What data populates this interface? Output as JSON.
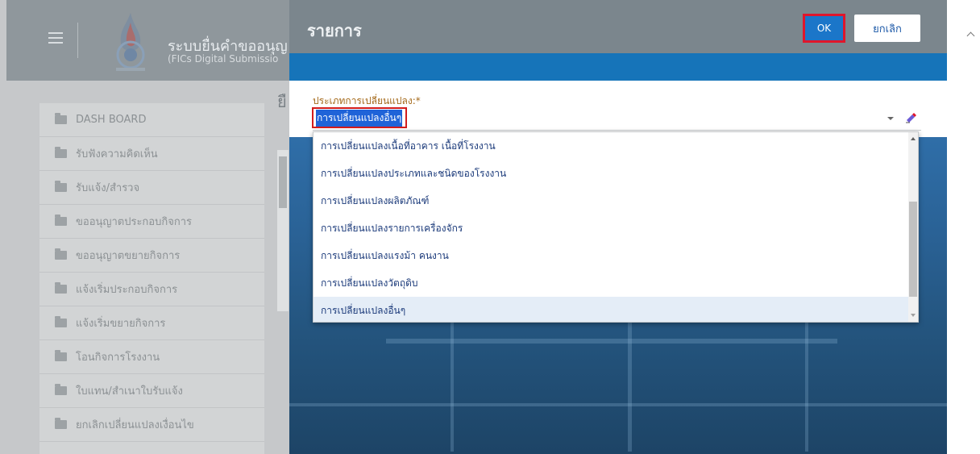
{
  "app": {
    "title": "ระบบยื่นคำขออนุญ",
    "subtitle": "(FICs Digital Submissio",
    "ghost_heading": "ยื"
  },
  "sidebar": {
    "items": [
      {
        "label": "DASH BOARD",
        "icon": "folder-icon"
      },
      {
        "label": "รับฟังความคิดเห็น",
        "icon": "folder-icon"
      },
      {
        "label": "รับแจ้ง/สำรวจ",
        "icon": "folder-icon"
      },
      {
        "label": "ขออนุญาตประกอบกิจการ",
        "icon": "folder-icon"
      },
      {
        "label": "ขออนุญาตขยายกิจการ",
        "icon": "folder-icon"
      },
      {
        "label": "แจ้งเริ่มประกอบกิจการ",
        "icon": "folder-icon"
      },
      {
        "label": "แจ้งเริ่มขยายกิจการ",
        "icon": "folder-icon"
      },
      {
        "label": "โอนกิจการโรงงาน",
        "icon": "folder-icon"
      },
      {
        "label": "ใบแทน/สำเนาใบรับแจ้ง",
        "icon": "folder-icon"
      },
      {
        "label": "ยกเลิกเปลี่ยนแปลงเงื่อนไข",
        "icon": "folder-icon"
      }
    ]
  },
  "modal": {
    "title": "รายการ",
    "ok_label": "OK",
    "cancel_label": "ยกเลิก",
    "field_label": "ประเภทการเปลี่ยนแปลง:*",
    "selected_value": "การเปลี่ยนแปลงอื่นๆ",
    "options": [
      "การเปลี่ยนแปลงเนื้อที่อาคาร เนื้อที่โรงงาน",
      "การเปลี่ยนแปลงประเภทและชนิดของโรงงาน",
      "การเปลี่ยนแปลงผลิตภัณฑ์",
      "การเปลี่ยนแปลงรายการเครื่องจักร",
      "การเปลี่ยนแปลงแรงม้า คนงาน",
      "การเปลี่ยนแปลงวัตถุดิบ",
      "การเปลี่ยนแปลงอื่นๆ"
    ],
    "active_option_index": 6
  },
  "colors": {
    "primary": "#1b76c9",
    "highlight_border": "#e0162b",
    "label": "#a56a1b",
    "option_text": "#1b3a7a"
  }
}
